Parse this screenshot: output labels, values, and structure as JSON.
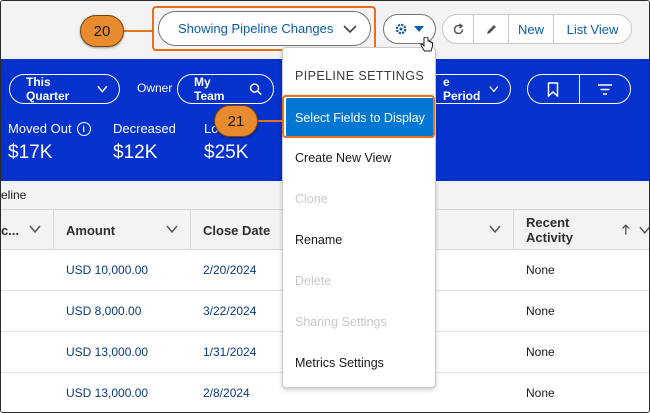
{
  "header": {
    "view_selector": "Showing Pipeline Changes",
    "buttons": {
      "new": "New",
      "list_view": "List View"
    }
  },
  "callouts": {
    "first": "20",
    "second": "21"
  },
  "filters": {
    "period": "This Quarter",
    "owner_label": "Owner",
    "owner": "My Team",
    "period_compare": "e Period"
  },
  "metrics": [
    {
      "label": "Moved Out",
      "value": "$17K"
    },
    {
      "label": "Decreased",
      "value": "$12K"
    },
    {
      "label": "Lo",
      "value": "$25K"
    }
  ],
  "pipeline_label": "eline",
  "table": {
    "columns": [
      "c...",
      "Amount",
      "Close Date",
      "",
      "Recent Activity"
    ],
    "rows": [
      {
        "amount": "USD 10,000.00",
        "close_date": "2/20/2024",
        "recent_activity": "None"
      },
      {
        "amount": "USD 8,000.00",
        "close_date": "3/22/2024",
        "recent_activity": "None"
      },
      {
        "amount": "USD 13,000.00",
        "close_date": "1/31/2024",
        "recent_activity": "None"
      },
      {
        "amount": "USD 13,000.00",
        "close_date": "2/8/2024",
        "recent_activity": "None"
      }
    ]
  },
  "menu": {
    "header": "PIPELINE SETTINGS",
    "items": [
      {
        "label": "Select Fields to Display",
        "state": "active"
      },
      {
        "label": "Create New View",
        "state": "enabled"
      },
      {
        "label": "Clone",
        "state": "disabled"
      },
      {
        "label": "Rename",
        "state": "enabled"
      },
      {
        "label": "Delete",
        "state": "disabled"
      },
      {
        "label": "Sharing Settings",
        "state": "disabled"
      },
      {
        "label": "Metrics Settings",
        "state": "enabled"
      }
    ]
  },
  "colors": {
    "brand_blue": "#0532cc",
    "accent_blue": "#0176d3",
    "callout_orange": "#e88b2e"
  }
}
